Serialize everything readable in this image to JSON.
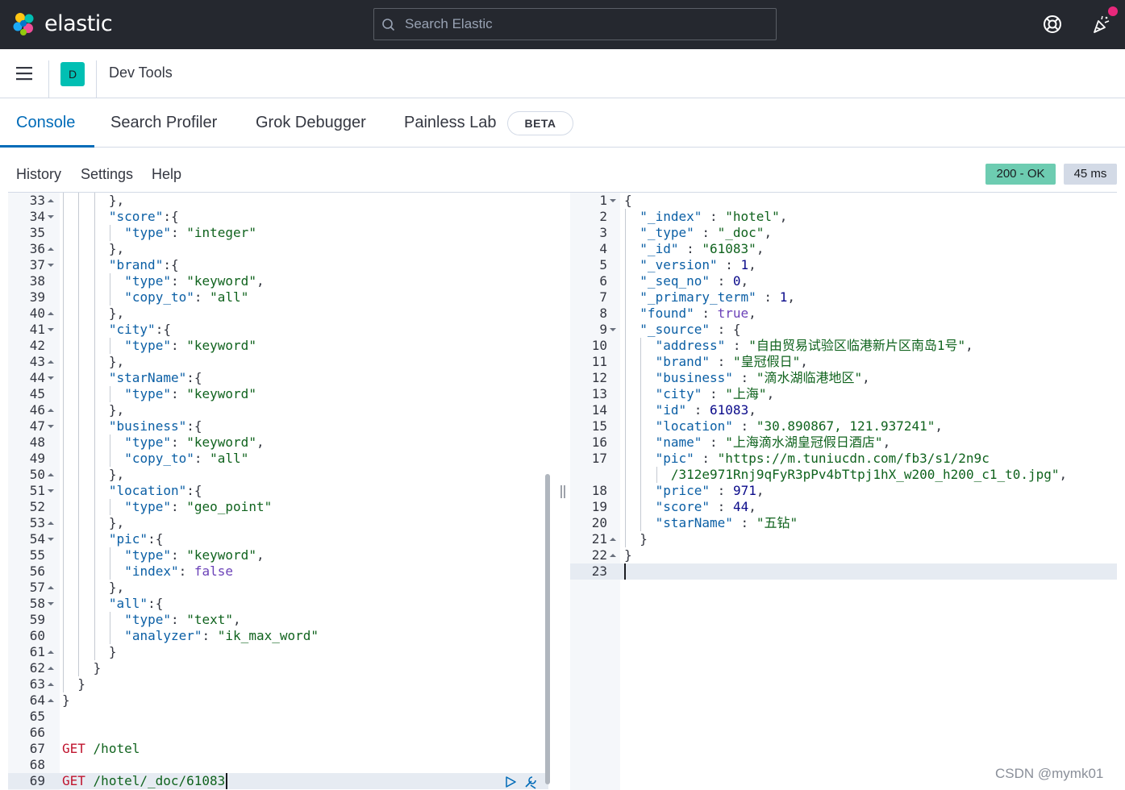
{
  "header": {
    "brand": "elastic",
    "search_placeholder": "Search Elastic"
  },
  "breadcrumb": {
    "space_initial": "D",
    "title": "Dev Tools"
  },
  "tabs": [
    {
      "label": "Console",
      "active": true
    },
    {
      "label": "Search Profiler",
      "active": false
    },
    {
      "label": "Grok Debugger",
      "active": false
    },
    {
      "label": "Painless Lab",
      "active": false
    }
  ],
  "beta_badge": "BETA",
  "toolbar": {
    "history": "History",
    "settings": "Settings",
    "help": "Help",
    "status": "200 - OK",
    "time": "45 ms"
  },
  "request_editor": {
    "lines": [
      {
        "n": "33",
        "fold": "up",
        "indent": 3,
        "parts": [
          [
            "punc",
            "},"
          ]
        ]
      },
      {
        "n": "34",
        "fold": "down",
        "indent": 3,
        "parts": [
          [
            "key",
            "\"score\""
          ],
          [
            "punc",
            ":{"
          ]
        ]
      },
      {
        "n": "35",
        "fold": "",
        "indent": 4,
        "parts": [
          [
            "key",
            "\"type\""
          ],
          [
            "punc",
            ": "
          ],
          [
            "str",
            "\"integer\""
          ]
        ]
      },
      {
        "n": "36",
        "fold": "up",
        "indent": 3,
        "parts": [
          [
            "punc",
            "},"
          ]
        ]
      },
      {
        "n": "37",
        "fold": "down",
        "indent": 3,
        "parts": [
          [
            "key",
            "\"brand\""
          ],
          [
            "punc",
            ":{"
          ]
        ]
      },
      {
        "n": "38",
        "fold": "",
        "indent": 4,
        "parts": [
          [
            "key",
            "\"type\""
          ],
          [
            "punc",
            ": "
          ],
          [
            "str",
            "\"keyword\""
          ],
          [
            "punc",
            ","
          ]
        ]
      },
      {
        "n": "39",
        "fold": "",
        "indent": 4,
        "parts": [
          [
            "key",
            "\"copy_to\""
          ],
          [
            "punc",
            ": "
          ],
          [
            "str",
            "\"all\""
          ]
        ]
      },
      {
        "n": "40",
        "fold": "up",
        "indent": 3,
        "parts": [
          [
            "punc",
            "},"
          ]
        ]
      },
      {
        "n": "41",
        "fold": "down",
        "indent": 3,
        "parts": [
          [
            "key",
            "\"city\""
          ],
          [
            "punc",
            ":{"
          ]
        ]
      },
      {
        "n": "42",
        "fold": "",
        "indent": 4,
        "parts": [
          [
            "key",
            "\"type\""
          ],
          [
            "punc",
            ": "
          ],
          [
            "str",
            "\"keyword\""
          ]
        ]
      },
      {
        "n": "43",
        "fold": "up",
        "indent": 3,
        "parts": [
          [
            "punc",
            "},"
          ]
        ]
      },
      {
        "n": "44",
        "fold": "down",
        "indent": 3,
        "parts": [
          [
            "key",
            "\"starName\""
          ],
          [
            "punc",
            ":{"
          ]
        ]
      },
      {
        "n": "45",
        "fold": "",
        "indent": 4,
        "parts": [
          [
            "key",
            "\"type\""
          ],
          [
            "punc",
            ": "
          ],
          [
            "str",
            "\"keyword\""
          ]
        ]
      },
      {
        "n": "46",
        "fold": "up",
        "indent": 3,
        "parts": [
          [
            "punc",
            "},"
          ]
        ]
      },
      {
        "n": "47",
        "fold": "down",
        "indent": 3,
        "parts": [
          [
            "key",
            "\"business\""
          ],
          [
            "punc",
            ":{"
          ]
        ]
      },
      {
        "n": "48",
        "fold": "",
        "indent": 4,
        "parts": [
          [
            "key",
            "\"type\""
          ],
          [
            "punc",
            ": "
          ],
          [
            "str",
            "\"keyword\""
          ],
          [
            "punc",
            ","
          ]
        ]
      },
      {
        "n": "49",
        "fold": "",
        "indent": 4,
        "parts": [
          [
            "key",
            "\"copy_to\""
          ],
          [
            "punc",
            ": "
          ],
          [
            "str",
            "\"all\""
          ]
        ]
      },
      {
        "n": "50",
        "fold": "up",
        "indent": 3,
        "parts": [
          [
            "punc",
            "},"
          ]
        ]
      },
      {
        "n": "51",
        "fold": "down",
        "indent": 3,
        "parts": [
          [
            "key",
            "\"location\""
          ],
          [
            "punc",
            ":{"
          ]
        ]
      },
      {
        "n": "52",
        "fold": "",
        "indent": 4,
        "parts": [
          [
            "key",
            "\"type\""
          ],
          [
            "punc",
            ": "
          ],
          [
            "str",
            "\"geo_point\""
          ]
        ]
      },
      {
        "n": "53",
        "fold": "up",
        "indent": 3,
        "parts": [
          [
            "punc",
            "},"
          ]
        ]
      },
      {
        "n": "54",
        "fold": "down",
        "indent": 3,
        "parts": [
          [
            "key",
            "\"pic\""
          ],
          [
            "punc",
            ":{"
          ]
        ]
      },
      {
        "n": "55",
        "fold": "",
        "indent": 4,
        "parts": [
          [
            "key",
            "\"type\""
          ],
          [
            "punc",
            ": "
          ],
          [
            "str",
            "\"keyword\""
          ],
          [
            "punc",
            ","
          ]
        ]
      },
      {
        "n": "56",
        "fold": "",
        "indent": 4,
        "parts": [
          [
            "key",
            "\"index\""
          ],
          [
            "punc",
            ": "
          ],
          [
            "bool",
            "false"
          ]
        ]
      },
      {
        "n": "57",
        "fold": "up",
        "indent": 3,
        "parts": [
          [
            "punc",
            "},"
          ]
        ]
      },
      {
        "n": "58",
        "fold": "down",
        "indent": 3,
        "parts": [
          [
            "key",
            "\"all\""
          ],
          [
            "punc",
            ":{"
          ]
        ]
      },
      {
        "n": "59",
        "fold": "",
        "indent": 4,
        "parts": [
          [
            "key",
            "\"type\""
          ],
          [
            "punc",
            ": "
          ],
          [
            "str",
            "\"text\""
          ],
          [
            "punc",
            ","
          ]
        ]
      },
      {
        "n": "60",
        "fold": "",
        "indent": 4,
        "parts": [
          [
            "key",
            "\"analyzer\""
          ],
          [
            "punc",
            ": "
          ],
          [
            "str",
            "\"ik_max_word\""
          ]
        ]
      },
      {
        "n": "61",
        "fold": "up",
        "indent": 3,
        "parts": [
          [
            "punc",
            "}"
          ]
        ]
      },
      {
        "n": "62",
        "fold": "up",
        "indent": 2,
        "parts": [
          [
            "punc",
            "}"
          ]
        ]
      },
      {
        "n": "63",
        "fold": "up",
        "indent": 1,
        "parts": [
          [
            "punc",
            "}"
          ]
        ]
      },
      {
        "n": "64",
        "fold": "up",
        "indent": 0,
        "parts": [
          [
            "punc",
            "}"
          ]
        ]
      },
      {
        "n": "65",
        "fold": "",
        "indent": 0,
        "parts": []
      },
      {
        "n": "66",
        "fold": "",
        "indent": 0,
        "parts": []
      },
      {
        "n": "67",
        "fold": "",
        "indent": 0,
        "parts": [
          [
            "method",
            "GET"
          ],
          [
            "punc",
            " "
          ],
          [
            "path",
            "/hotel"
          ]
        ]
      },
      {
        "n": "68",
        "fold": "",
        "indent": 0,
        "parts": []
      },
      {
        "n": "69",
        "fold": "",
        "indent": 0,
        "active": true,
        "parts": [
          [
            "method",
            "GET"
          ],
          [
            "punc",
            " "
          ],
          [
            "path",
            "/hotel/_doc/61083"
          ]
        ]
      }
    ]
  },
  "response_editor": {
    "lines": [
      {
        "n": "1",
        "fold": "down",
        "indent": 0,
        "parts": [
          [
            "punc",
            "{"
          ]
        ]
      },
      {
        "n": "2",
        "fold": "",
        "indent": 1,
        "parts": [
          [
            "key",
            "\"_index\""
          ],
          [
            "punc",
            " : "
          ],
          [
            "str",
            "\"hotel\""
          ],
          [
            "punc",
            ","
          ]
        ]
      },
      {
        "n": "3",
        "fold": "",
        "indent": 1,
        "parts": [
          [
            "key",
            "\"_type\""
          ],
          [
            "punc",
            " : "
          ],
          [
            "str",
            "\"_doc\""
          ],
          [
            "punc",
            ","
          ]
        ]
      },
      {
        "n": "4",
        "fold": "",
        "indent": 1,
        "parts": [
          [
            "key",
            "\"_id\""
          ],
          [
            "punc",
            " : "
          ],
          [
            "str",
            "\"61083\""
          ],
          [
            "punc",
            ","
          ]
        ]
      },
      {
        "n": "5",
        "fold": "",
        "indent": 1,
        "parts": [
          [
            "key",
            "\"_version\""
          ],
          [
            "punc",
            " : "
          ],
          [
            "num",
            "1"
          ],
          [
            "punc",
            ","
          ]
        ]
      },
      {
        "n": "6",
        "fold": "",
        "indent": 1,
        "parts": [
          [
            "key",
            "\"_seq_no\""
          ],
          [
            "punc",
            " : "
          ],
          [
            "num",
            "0"
          ],
          [
            "punc",
            ","
          ]
        ]
      },
      {
        "n": "7",
        "fold": "",
        "indent": 1,
        "parts": [
          [
            "key",
            "\"_primary_term\""
          ],
          [
            "punc",
            " : "
          ],
          [
            "num",
            "1"
          ],
          [
            "punc",
            ","
          ]
        ]
      },
      {
        "n": "8",
        "fold": "",
        "indent": 1,
        "parts": [
          [
            "key",
            "\"found\""
          ],
          [
            "punc",
            " : "
          ],
          [
            "bool",
            "true"
          ],
          [
            "punc",
            ","
          ]
        ]
      },
      {
        "n": "9",
        "fold": "down",
        "indent": 1,
        "parts": [
          [
            "key",
            "\"_source\""
          ],
          [
            "punc",
            " : {"
          ]
        ]
      },
      {
        "n": "10",
        "fold": "",
        "indent": 2,
        "parts": [
          [
            "key",
            "\"address\""
          ],
          [
            "punc",
            " : "
          ],
          [
            "str",
            "\"自由贸易试验区临港新片区南岛1号\""
          ],
          [
            "punc",
            ","
          ]
        ]
      },
      {
        "n": "11",
        "fold": "",
        "indent": 2,
        "parts": [
          [
            "key",
            "\"brand\""
          ],
          [
            "punc",
            " : "
          ],
          [
            "str",
            "\"皇冠假日\""
          ],
          [
            "punc",
            ","
          ]
        ]
      },
      {
        "n": "12",
        "fold": "",
        "indent": 2,
        "parts": [
          [
            "key",
            "\"business\""
          ],
          [
            "punc",
            " : "
          ],
          [
            "str",
            "\"滴水湖临港地区\""
          ],
          [
            "punc",
            ","
          ]
        ]
      },
      {
        "n": "13",
        "fold": "",
        "indent": 2,
        "parts": [
          [
            "key",
            "\"city\""
          ],
          [
            "punc",
            " : "
          ],
          [
            "str",
            "\"上海\""
          ],
          [
            "punc",
            ","
          ]
        ]
      },
      {
        "n": "14",
        "fold": "",
        "indent": 2,
        "parts": [
          [
            "key",
            "\"id\""
          ],
          [
            "punc",
            " : "
          ],
          [
            "num",
            "61083"
          ],
          [
            "punc",
            ","
          ]
        ]
      },
      {
        "n": "15",
        "fold": "",
        "indent": 2,
        "parts": [
          [
            "key",
            "\"location\""
          ],
          [
            "punc",
            " : "
          ],
          [
            "str",
            "\"30.890867, 121.937241\""
          ],
          [
            "punc",
            ","
          ]
        ]
      },
      {
        "n": "16",
        "fold": "",
        "indent": 2,
        "parts": [
          [
            "key",
            "\"name\""
          ],
          [
            "punc",
            " : "
          ],
          [
            "str",
            "\"上海滴水湖皇冠假日酒店\""
          ],
          [
            "punc",
            ","
          ]
        ]
      },
      {
        "n": "17",
        "fold": "",
        "indent": 2,
        "parts": [
          [
            "key",
            "\"pic\""
          ],
          [
            "punc",
            " : "
          ],
          [
            "str",
            "\"https://m.tuniucdn.com/fb3/s1/2n9c"
          ]
        ]
      },
      {
        "n": "",
        "fold": "",
        "indent": 3,
        "parts": [
          [
            "str",
            "/312e971Rnj9qFyR3pPv4bTtpj1hX_w200_h200_c1_t0.jpg\""
          ],
          [
            "punc",
            ","
          ]
        ]
      },
      {
        "n": "18",
        "fold": "",
        "indent": 2,
        "parts": [
          [
            "key",
            "\"price\""
          ],
          [
            "punc",
            " : "
          ],
          [
            "num",
            "971"
          ],
          [
            "punc",
            ","
          ]
        ]
      },
      {
        "n": "19",
        "fold": "",
        "indent": 2,
        "parts": [
          [
            "key",
            "\"score\""
          ],
          [
            "punc",
            " : "
          ],
          [
            "num",
            "44"
          ],
          [
            "punc",
            ","
          ]
        ]
      },
      {
        "n": "20",
        "fold": "",
        "indent": 2,
        "parts": [
          [
            "key",
            "\"starName\""
          ],
          [
            "punc",
            " : "
          ],
          [
            "str",
            "\"五钻\""
          ]
        ]
      },
      {
        "n": "21",
        "fold": "up",
        "indent": 1,
        "parts": [
          [
            "punc",
            "}"
          ]
        ]
      },
      {
        "n": "22",
        "fold": "up",
        "indent": 0,
        "parts": [
          [
            "punc",
            "}"
          ]
        ]
      },
      {
        "n": "23",
        "fold": "",
        "indent": 0,
        "active": true,
        "parts": []
      }
    ]
  },
  "watermark": "CSDN @mymk01"
}
